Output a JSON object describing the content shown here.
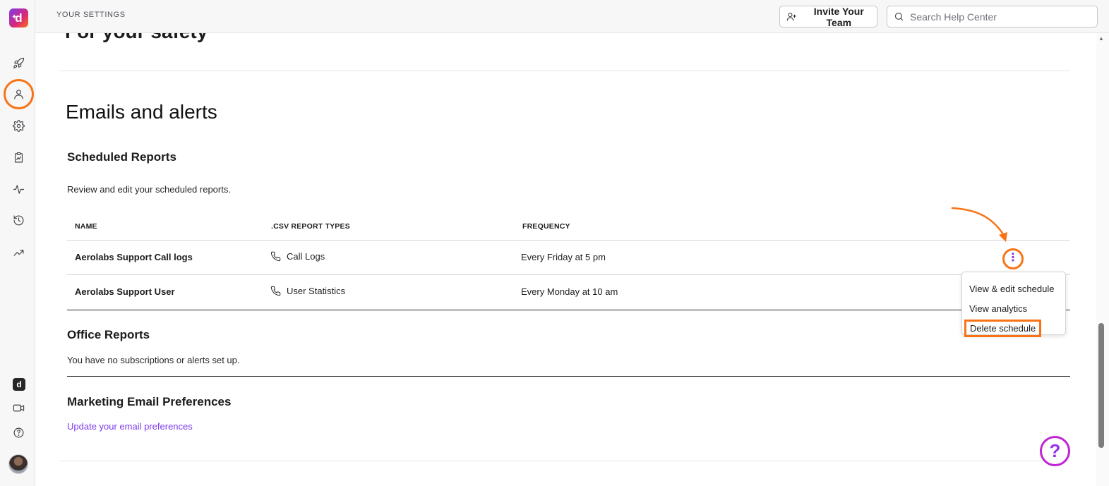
{
  "topbar": {
    "title": "YOUR SETTINGS",
    "invite_label": "Invite Your Team",
    "search_placeholder": "Search Help Center"
  },
  "sidebar": {
    "logo_letter": "d",
    "items": [
      {
        "icon": "rocket-icon"
      },
      {
        "icon": "user-icon",
        "active": true
      },
      {
        "icon": "gear-icon"
      },
      {
        "icon": "clipboard-chart-icon"
      },
      {
        "icon": "pulse-icon"
      },
      {
        "icon": "history-icon"
      },
      {
        "icon": "trending-up-icon"
      }
    ],
    "bottom_items": [
      {
        "icon": "dialpad-app-icon",
        "letter": "d"
      },
      {
        "icon": "video-icon"
      },
      {
        "icon": "help-circle-icon"
      },
      {
        "icon": "avatar"
      }
    ]
  },
  "content": {
    "prev_section_title": "For your safety",
    "section_title": "Emails and alerts",
    "scheduled": {
      "title": "Scheduled Reports",
      "description": "Review and edit your scheduled reports.",
      "columns": [
        "NAME",
        ".CSV REPORT TYPES",
        "FREQUENCY"
      ],
      "rows": [
        {
          "name": "Aerolabs Support Call logs",
          "type": "Call Logs",
          "frequency": "Every Friday at 5 pm"
        },
        {
          "name": "Aerolabs Support User",
          "type": "User Statistics",
          "frequency": "Every Monday at 10 am"
        }
      ],
      "more_glyph": "⋮",
      "menu": [
        "View & edit schedule",
        "View analytics",
        "Delete schedule"
      ]
    },
    "office": {
      "title": "Office Reports",
      "description": "You have no subscriptions or alerts set up."
    },
    "marketing": {
      "title": "Marketing Email Preferences",
      "link": "Update your email preferences"
    }
  },
  "help_fab_glyph": "?",
  "colors": {
    "highlight": "#f97316",
    "accent": "#7c3aed",
    "help": "#c026d3"
  }
}
